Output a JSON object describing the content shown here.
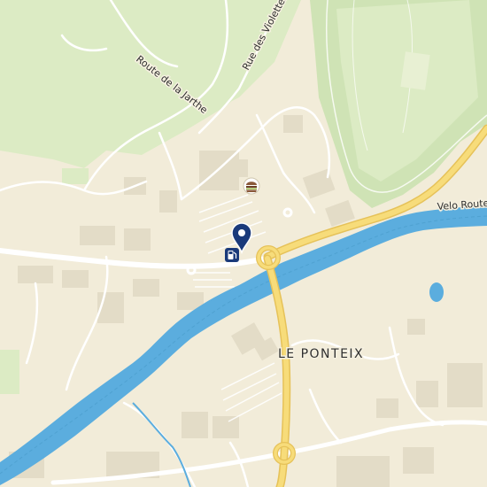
{
  "map": {
    "labels": {
      "route_de_la_jarthe": "Route de la Jarthe",
      "rue_des_violettes": "Rue des Violettes",
      "velo_route": "Velo Route",
      "le_ponteix": "LE PONTEIX"
    },
    "markers": {
      "selected_pin": "location-pin-icon",
      "fuel_station": "fuel-station-icon",
      "restaurant": "burger-icon"
    },
    "colors": {
      "land": "#f2ecd9",
      "forest": "#dcebc4",
      "forest_dark": "#cfe3b5",
      "water": "#5badde",
      "road_main": "#ffffff",
      "road_primary": "#f7dc7a",
      "building": "#e3dcc7",
      "pin": "#1a3a7a"
    }
  }
}
